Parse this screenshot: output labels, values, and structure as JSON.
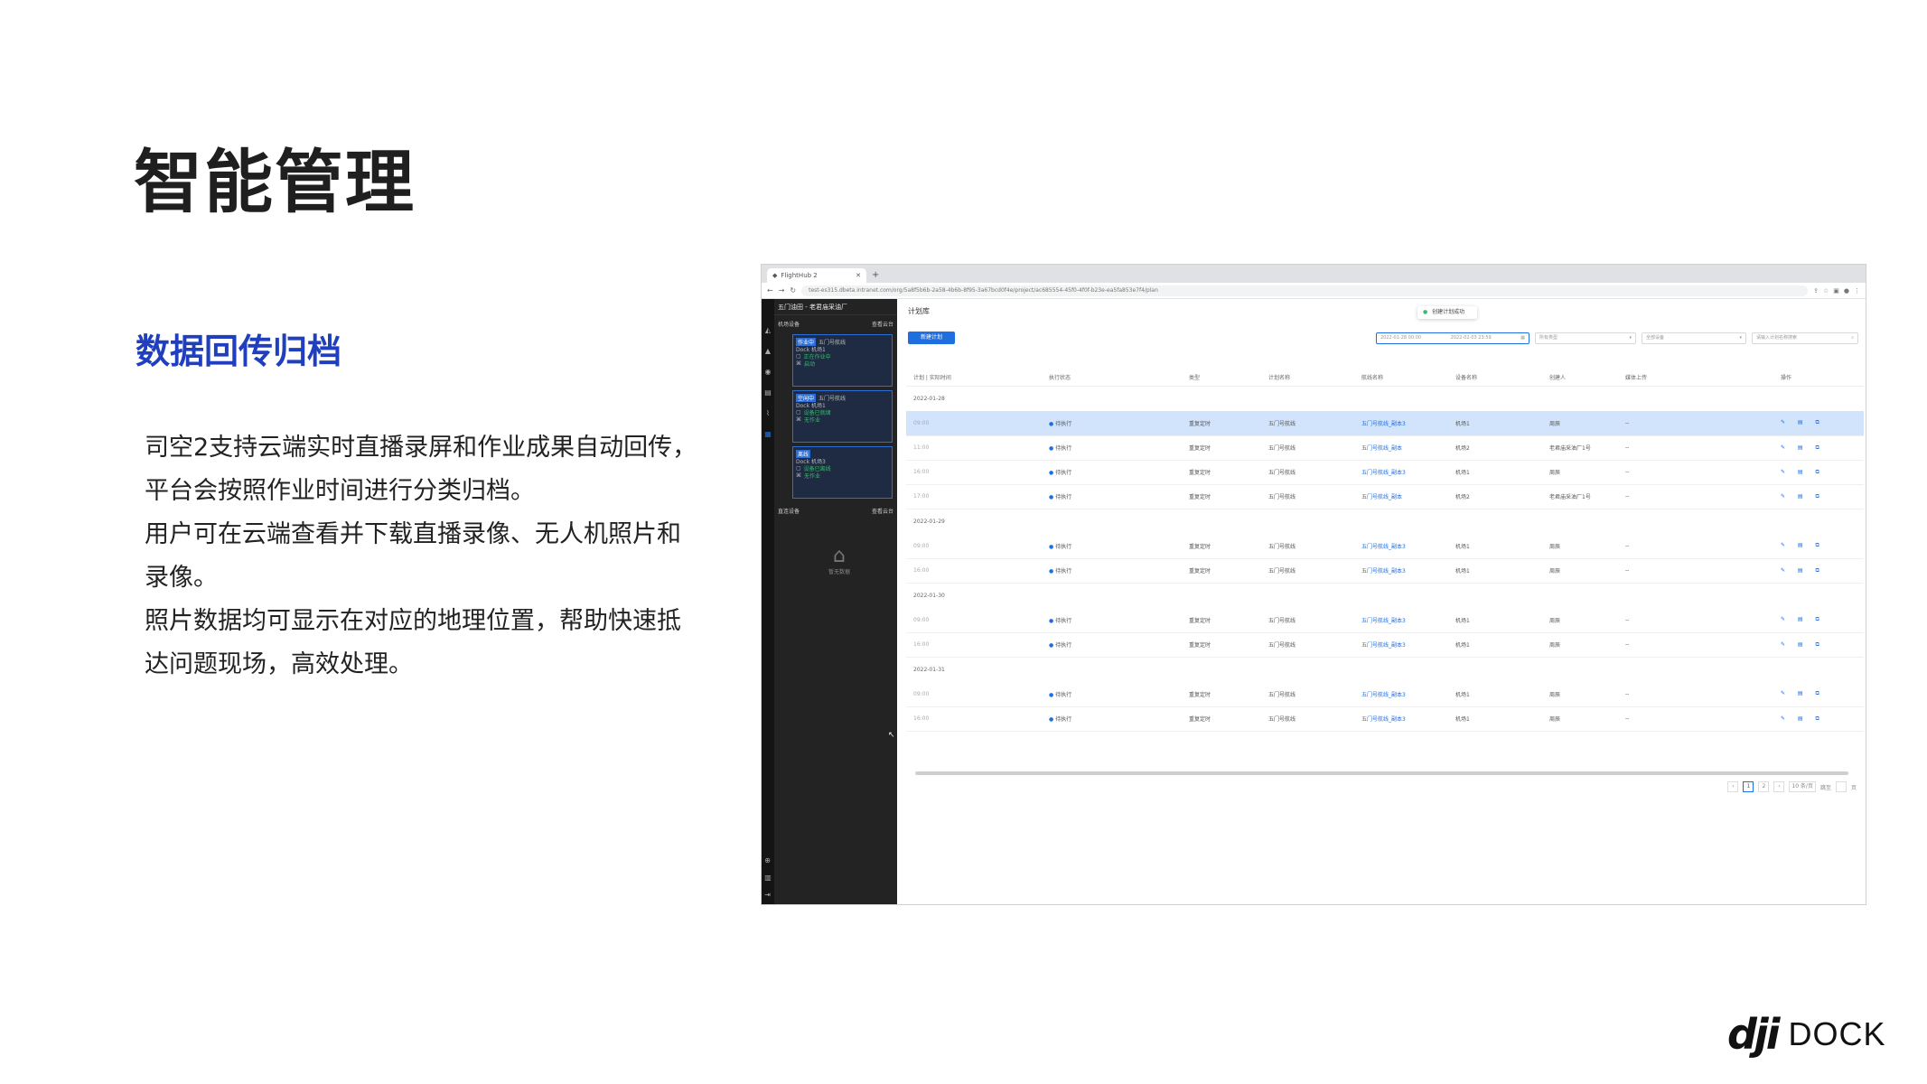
{
  "slide": {
    "title": "智能管理",
    "section_title": "数据回传归档",
    "body_lines": [
      "司空2支持云端实时直播录屏和作业成果自动回传，",
      "平台会按照作业时间进行分类归档。",
      "用户可在云端查看并下载直播录像、无人机照片和",
      "录像。",
      "照片数据均可显示在对应的地理位置，帮助快速抵",
      "达问题现场，高效处理。"
    ],
    "logo_mark": "dji",
    "logo_word": "DOCK"
  },
  "screenshot": {
    "browser": {
      "tab_label": "FlightHub 2",
      "url": "test-es315.dbeta.intranet.com/org/5a8f5b6b-2a58-4b6b-8f95-3a67bcd0f4e/project/ac685554-45f0-4f0f-b23e-ea5fa853e7f4/plan"
    },
    "sidebar": {
      "project_title": "五门油田 - 老君庙采油厂",
      "dock_section_label": "机场设备",
      "dock_toggle_label": "查看云台",
      "docks": [
        {
          "tag": "作业中",
          "name": "五门号航线",
          "model": "Dock 机场1",
          "status1": "正在作业中",
          "status2": "启动"
        },
        {
          "tag": "空闲中",
          "name": "五门号航线",
          "model": "Dock 机场1",
          "status1": "设备已就绪",
          "status2": "无作业"
        },
        {
          "tag": "离线",
          "name": "",
          "model": "Dock 机场3",
          "status1": "设备已离线",
          "status2": "无作业"
        }
      ],
      "drone_section_label": "直连设备",
      "drone_toggle_label": "查看云台",
      "empty_label": "暂无数据"
    },
    "main": {
      "title": "计划库",
      "toast": "创建计划成功",
      "new_button": "新建计划",
      "filters": {
        "date_start": "2022-01-28 00:00",
        "date_end": "2022-02-03 23:59",
        "type_placeholder": "所有类型",
        "device_placeholder": "全部设备",
        "search_placeholder": "请输入计划名称搜索"
      },
      "columns": [
        "计划 | 实际时间",
        "执行状态",
        "类型",
        "计划名称",
        "航线名称",
        "设备名称",
        "创建人",
        "媒体上传",
        "操作"
      ],
      "groups": [
        {
          "date": "2022-01-28",
          "rows": [
            {
              "time": "09:00",
              "status": "待执行",
              "type": "重复定时",
              "plan": "五门号航线",
              "route": "五门号航线_副本3",
              "device": "机场1",
              "creator": "周辰",
              "media": "--",
              "selected": true
            },
            {
              "time": "11:00",
              "status": "待执行",
              "type": "重复定时",
              "plan": "五门号航线",
              "route": "五门号航线_副本",
              "device": "机场2",
              "creator": "老君庙采油厂1号",
              "media": "--",
              "selected": false
            },
            {
              "time": "16:00",
              "status": "待执行",
              "type": "重复定时",
              "plan": "五门号航线",
              "route": "五门号航线_副本3",
              "device": "机场1",
              "creator": "周辰",
              "media": "--",
              "selected": false
            },
            {
              "time": "17:00",
              "status": "待执行",
              "type": "重复定时",
              "plan": "五门号航线",
              "route": "五门号航线_副本",
              "device": "机场2",
              "creator": "老君庙采油厂1号",
              "media": "--",
              "selected": false
            }
          ]
        },
        {
          "date": "2022-01-29",
          "rows": [
            {
              "time": "09:00",
              "status": "待执行",
              "type": "重复定时",
              "plan": "五门号航线",
              "route": "五门号航线_副本3",
              "device": "机场1",
              "creator": "周辰",
              "media": "--",
              "selected": false
            },
            {
              "time": "16:00",
              "status": "待执行",
              "type": "重复定时",
              "plan": "五门号航线",
              "route": "五门号航线_副本3",
              "device": "机场1",
              "creator": "周辰",
              "media": "--",
              "selected": false
            }
          ]
        },
        {
          "date": "2022-01-30",
          "rows": [
            {
              "time": "09:00",
              "status": "待执行",
              "type": "重复定时",
              "plan": "五门号航线",
              "route": "五门号航线_副本3",
              "device": "机场1",
              "creator": "周辰",
              "media": "--",
              "selected": false
            },
            {
              "time": "16:00",
              "status": "待执行",
              "type": "重复定时",
              "plan": "五门号航线",
              "route": "五门号航线_副本3",
              "device": "机场1",
              "creator": "周辰",
              "media": "--",
              "selected": false
            }
          ]
        },
        {
          "date": "2022-01-31",
          "rows": [
            {
              "time": "09:00",
              "status": "待执行",
              "type": "重复定时",
              "plan": "五门号航线",
              "route": "五门号航线_副本3",
              "device": "机场1",
              "creator": "周辰",
              "media": "--",
              "selected": false
            },
            {
              "time": "16:00",
              "status": "待执行",
              "type": "重复定时",
              "plan": "五门号航线",
              "route": "五门号航线_副本3",
              "device": "机场1",
              "creator": "周辰",
              "media": "--",
              "selected": false
            }
          ]
        }
      ],
      "row_ops": "✎ ▤ ⧉",
      "pager": {
        "prev": "‹",
        "pages": [
          "1",
          "2"
        ],
        "current": "1",
        "next": "›",
        "page_size": "10 条/页",
        "jump_label": "跳至",
        "jump_unit": "页"
      }
    }
  },
  "colors": {
    "accent": "#1f3fbf",
    "primary": "#1f6fe0",
    "sidebar_bg": "#232323",
    "selected_row": "#d2e4fb"
  }
}
